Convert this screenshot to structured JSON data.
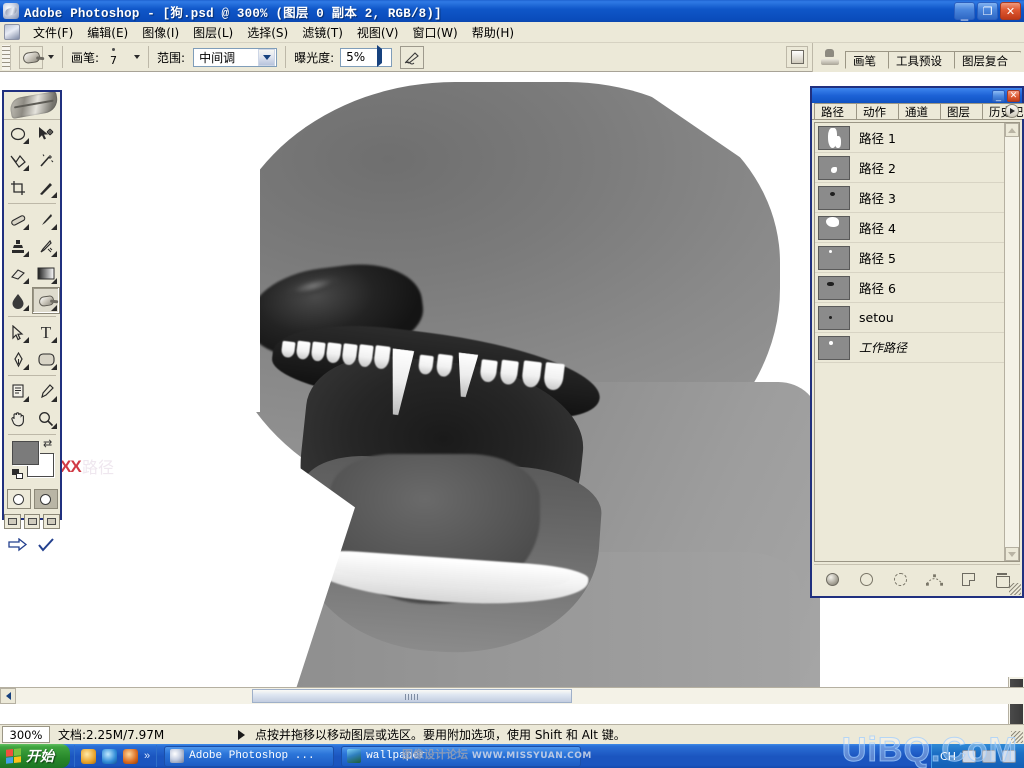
{
  "window": {
    "title": "Adobe Photoshop - [狗.psd @ 300% (图层 0 副本 2, RGB/8)]",
    "icon": "photoshop-icon",
    "minimize": "_",
    "maximize": "❐",
    "close": "✕"
  },
  "menu": {
    "items": [
      {
        "label": "文件(F)"
      },
      {
        "label": "编辑(E)"
      },
      {
        "label": "图像(I)"
      },
      {
        "label": "图层(L)"
      },
      {
        "label": "选择(S)"
      },
      {
        "label": "滤镜(T)"
      },
      {
        "label": "视图(V)"
      },
      {
        "label": "窗口(W)"
      },
      {
        "label": "帮助(H)"
      }
    ]
  },
  "options_bar": {
    "tool_icon": "burn-tool-icon",
    "brush_label": "画笔:",
    "brush_size": "7",
    "range_label": "范围:",
    "range_value": "中间调",
    "exposure_label": "曝光度:",
    "exposure_value": "5%",
    "airbrush_icon": "airbrush-icon",
    "docked_well_icon": "file-browser-icon"
  },
  "palette_well": {
    "tabs": [
      "画笔",
      "工具预设",
      "图层复合"
    ]
  },
  "toolbox": {
    "logo": "feather-logo",
    "tools": [
      {
        "name": "marquee-tool",
        "glyph": "◯"
      },
      {
        "name": "move-tool",
        "glyph": "➤"
      },
      {
        "name": "lasso-tool",
        "glyph": "🕸"
      },
      {
        "name": "magic-wand-tool",
        "glyph": "✳"
      },
      {
        "name": "crop-tool",
        "glyph": "⌗"
      },
      {
        "name": "slice-tool",
        "glyph": "✎"
      },
      {
        "name": "healing-brush-tool",
        "glyph": "◍"
      },
      {
        "name": "brush-tool",
        "glyph": "🖌"
      },
      {
        "name": "clone-stamp-tool",
        "glyph": "⚲"
      },
      {
        "name": "history-brush-tool",
        "glyph": "✒"
      },
      {
        "name": "eraser-tool",
        "glyph": "▱"
      },
      {
        "name": "gradient-tool",
        "glyph": "▤"
      },
      {
        "name": "blur-tool",
        "glyph": "💧"
      },
      {
        "name": "dodge-burn-tool",
        "glyph": "◔"
      },
      {
        "name": "path-selection-tool",
        "glyph": "➤"
      },
      {
        "name": "type-tool",
        "glyph": "T"
      },
      {
        "name": "pen-tool",
        "glyph": "✑"
      },
      {
        "name": "shape-tool",
        "glyph": "▭"
      },
      {
        "name": "notes-tool",
        "glyph": "🗒"
      },
      {
        "name": "eyedropper-tool",
        "glyph": "✐"
      },
      {
        "name": "hand-tool",
        "glyph": "✋"
      },
      {
        "name": "zoom-tool",
        "glyph": "🔍"
      }
    ],
    "selected_tool": "dodge-burn-tool",
    "foreground_color": "#7b7b7b",
    "background_color": "#ffffff",
    "swap_icon": "swap-colors-icon",
    "reset_icon": "default-colors-icon",
    "quickmask": [
      "standard-mode",
      "quick-mask-mode"
    ],
    "screenmodes": [
      "standard-screen-mode",
      "full-screen-menubar-mode",
      "full-screen-mode"
    ],
    "jump_to": "jump-to-imageready"
  },
  "paths_panel": {
    "tabs": [
      "路径",
      "动作",
      "通道",
      "图层",
      "历史记录"
    ],
    "active_tab": "路径",
    "menu_icon": "palette-menu-icon",
    "minimize": "_",
    "close": "✕",
    "items": [
      {
        "name": "路径 1",
        "italic": false
      },
      {
        "name": "路径 2",
        "italic": false
      },
      {
        "name": "路径 3",
        "italic": false
      },
      {
        "name": "路径 4",
        "italic": false
      },
      {
        "name": "路径 5",
        "italic": false
      },
      {
        "name": "路径 6",
        "italic": false
      },
      {
        "name": "setou",
        "italic": false
      },
      {
        "name": "工作路径",
        "italic": true
      }
    ],
    "footer_buttons": [
      "fill-path-icon",
      "stroke-path-icon",
      "load-path-as-selection-icon",
      "make-work-path-icon",
      "new-path-icon",
      "delete-path-icon"
    ]
  },
  "canvas": {
    "overlay_text": "XX",
    "ghost_text": "路径"
  },
  "status_bar": {
    "zoom": "300%",
    "doc_info": "文档:2.25M/7.97M",
    "hint": "点按并拖移以移动图层或选区。要用附加选项，使用 Shift 和 Alt 键。"
  },
  "taskbar": {
    "start_label": "开始",
    "quicklaunch_more": "»",
    "items": [
      {
        "label": "Adobe Photoshop ...",
        "icon": "photoshop-icon"
      },
      {
        "label": "wallpaper",
        "icon": "image-icon"
      }
    ],
    "tray": {
      "ime": "CH",
      "icons": [
        "keyboard-icon",
        "network-icon",
        "volume-icon"
      ]
    }
  },
  "watermarks": {
    "corner": "UiBQ.CoM",
    "taskbar_cn": "图像设计论坛",
    "taskbar_url": "WWW.MISSYUAN.COM"
  },
  "colors": {
    "titlebar_blue": "#0f56c8",
    "chrome_beige": "#ece9d8",
    "panel_border_navy": "#20307f",
    "accent_red": "#d03a45"
  }
}
